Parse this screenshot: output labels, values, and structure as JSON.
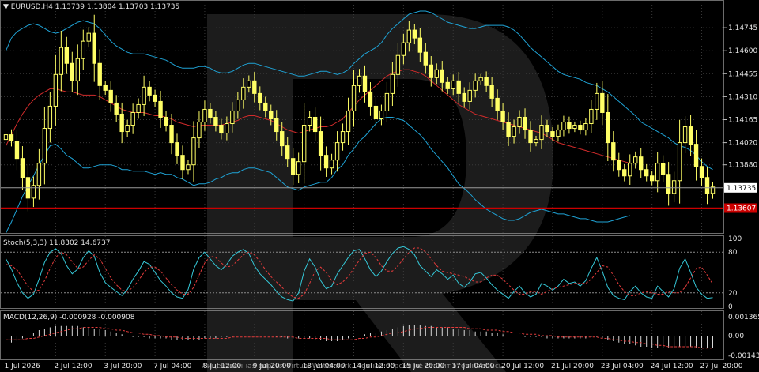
{
  "window": {
    "symbol_header": "EURUSD,H4",
    "ohlc_header": "1.13739 1.13804 1.13703 1.13735",
    "watermark": "Лицензионная версия Virtual Watermark. Полная версия не ставит этот надпись"
  },
  "colors": {
    "background": "#000000",
    "grid": "#3a3a3a",
    "candle": "#ffff66",
    "bb_band": "#1fa3d6",
    "bb_mid": "#d12b2b",
    "stoch_main": "#35c8d8",
    "stoch_signal": "#e23b3b",
    "macd_hist": "#d9d9d9",
    "macd_signal": "#e23b3b",
    "price_line": "#9a9a9a",
    "level_line": "#cc0000",
    "axis_text": "#e6e6e6",
    "bid_tag": "#ffffff",
    "level_tag": "#cc0000"
  },
  "chart_data": [
    {
      "type": "candlestick",
      "name": "",
      "pane": "price",
      "ylim": [
        1.1346,
        1.1487
      ],
      "y_ticks": [
        1.14745,
        1.146,
        1.14455,
        1.1431,
        1.14165,
        1.1402,
        1.1388
      ],
      "current_price": 1.13735,
      "level_price": 1.13607,
      "level_label": "1.13607",
      "current_label": "1.13735",
      "x_ticks": [
        "1 Jul 2026",
        "2 Jul 12:00",
        "3 Jul 20:00",
        "7 Jul 04:00",
        "8 Jul 12:00",
        "9 Jul 20:00",
        "13 Jul 04:00",
        "14 Jul 12:00",
        "15 Jul 20:00",
        "17 Jul 04:00",
        "20 Jul 12:00",
        "21 Jul 20:00",
        "23 Jul 04:00",
        "24 Jul 12:00",
        "27 Jul 20:00"
      ],
      "x_tick_index": [
        0,
        9,
        18,
        27,
        36,
        45,
        54,
        63,
        72,
        81,
        90,
        99,
        108,
        117,
        126
      ],
      "close": [
        1.1407,
        1.1403,
        1.1392,
        1.138,
        1.1367,
        1.1375,
        1.1389,
        1.1411,
        1.1425,
        1.1445,
        1.1462,
        1.1452,
        1.1441,
        1.1455,
        1.1466,
        1.1471,
        1.1452,
        1.1438,
        1.1435,
        1.1427,
        1.142,
        1.1409,
        1.1413,
        1.1421,
        1.1426,
        1.1437,
        1.1432,
        1.1428,
        1.1418,
        1.1413,
        1.1402,
        1.1394,
        1.1385,
        1.1388,
        1.1405,
        1.1415,
        1.1423,
        1.1418,
        1.1413,
        1.1408,
        1.1414,
        1.1422,
        1.1429,
        1.1437,
        1.1441,
        1.1433,
        1.1427,
        1.1422,
        1.1417,
        1.1409,
        1.14,
        1.1392,
        1.1382,
        1.139,
        1.1413,
        1.1418,
        1.1409,
        1.1394,
        1.1386,
        1.1391,
        1.1402,
        1.1409,
        1.1422,
        1.1438,
        1.1444,
        1.1434,
        1.1425,
        1.1417,
        1.1422,
        1.1433,
        1.1445,
        1.1457,
        1.1465,
        1.1473,
        1.1468,
        1.1459,
        1.1451,
        1.1443,
        1.1448,
        1.144,
        1.1436,
        1.1441,
        1.1433,
        1.1428,
        1.1435,
        1.1441,
        1.1443,
        1.1438,
        1.143,
        1.1422,
        1.1415,
        1.1406,
        1.1412,
        1.1418,
        1.141,
        1.1402,
        1.1404,
        1.1413,
        1.1409,
        1.1406,
        1.141,
        1.1415,
        1.1411,
        1.1413,
        1.141,
        1.1414,
        1.1423,
        1.1433,
        1.1421,
        1.1402,
        1.1391,
        1.1385,
        1.1381,
        1.1389,
        1.1393,
        1.1385,
        1.1381,
        1.1378,
        1.1389,
        1.1382,
        1.137,
        1.1378,
        1.1402,
        1.1412,
        1.1401,
        1.1387,
        1.138,
        1.137,
        1.1374
      ],
      "bb_upper": [
        1.146,
        1.1468,
        1.1472,
        1.1474,
        1.1476,
        1.1477,
        1.1476,
        1.1474,
        1.1472,
        1.1471,
        1.1472,
        1.1474,
        1.1476,
        1.1478,
        1.1479,
        1.1478,
        1.1477,
        1.1474,
        1.147,
        1.1466,
        1.1463,
        1.1461,
        1.1459,
        1.1458,
        1.1458,
        1.1458,
        1.1457,
        1.1456,
        1.1455,
        1.1454,
        1.1452,
        1.145,
        1.1449,
        1.1449,
        1.1449,
        1.145,
        1.145,
        1.1449,
        1.1447,
        1.1446,
        1.1446,
        1.1447,
        1.1449,
        1.1451,
        1.1452,
        1.1452,
        1.1451,
        1.145,
        1.1449,
        1.1448,
        1.1447,
        1.1446,
        1.1445,
        1.1444,
        1.1444,
        1.1445,
        1.1446,
        1.1447,
        1.1447,
        1.1446,
        1.1445,
        1.1446,
        1.1448,
        1.1452,
        1.1455,
        1.1458,
        1.146,
        1.1462,
        1.1465,
        1.147,
        1.1474,
        1.1477,
        1.148,
        1.1483,
        1.1484,
        1.1485,
        1.1485,
        1.1484,
        1.1482,
        1.148,
        1.1478,
        1.1477,
        1.1476,
        1.1475,
        1.1474,
        1.1474,
        1.1475,
        1.1476,
        1.1476,
        1.1476,
        1.1476,
        1.1475,
        1.1473,
        1.147,
        1.1466,
        1.1462,
        1.1459,
        1.1456,
        1.1453,
        1.145,
        1.1447,
        1.1445,
        1.1444,
        1.1443,
        1.1442,
        1.144,
        1.1439,
        1.1438,
        1.1436,
        1.1434,
        1.1431,
        1.1428,
        1.1425,
        1.1422,
        1.1419,
        1.1415,
        1.1413,
        1.1411,
        1.1409,
        1.1407,
        1.1405,
        1.1402,
        1.14,
        1.1399,
        1.1397,
        1.1394,
        1.139,
        1.1387,
        1.1385
      ],
      "bb_mid": [
        1.14,
        1.1407,
        1.1414,
        1.142,
        1.1425,
        1.1429,
        1.1432,
        1.1434,
        1.1436,
        1.1436,
        1.1435,
        1.1434,
        1.1434,
        1.1433,
        1.1432,
        1.1432,
        1.1432,
        1.1431,
        1.1429,
        1.1427,
        1.1425,
        1.1423,
        1.1422,
        1.1421,
        1.1421,
        1.1421,
        1.142,
        1.1419,
        1.1419,
        1.1418,
        1.1417,
        1.1415,
        1.1414,
        1.1413,
        1.1412,
        1.1413,
        1.1413,
        1.1413,
        1.1413,
        1.1413,
        1.1414,
        1.1415,
        1.1416,
        1.1418,
        1.1419,
        1.1419,
        1.1418,
        1.1417,
        1.1416,
        1.1414,
        1.1412,
        1.141,
        1.1409,
        1.1408,
        1.1409,
        1.141,
        1.1411,
        1.1412,
        1.1412,
        1.1413,
        1.1415,
        1.1417,
        1.1421,
        1.1425,
        1.1429,
        1.1432,
        1.1435,
        1.1438,
        1.1441,
        1.1444,
        1.1446,
        1.1447,
        1.1448,
        1.1448,
        1.1447,
        1.1446,
        1.1444,
        1.1441,
        1.1438,
        1.1435,
        1.1432,
        1.1429,
        1.1426,
        1.1424,
        1.1422,
        1.142,
        1.1419,
        1.1418,
        1.1417,
        1.1416,
        1.1415,
        1.1414,
        1.1413,
        1.1412,
        1.1411,
        1.141,
        1.1409,
        1.1408,
        1.1406,
        1.1404,
        1.1402,
        1.1401,
        1.14,
        1.1399,
        1.1398,
        1.1397,
        1.1396,
        1.1395,
        1.1394,
        1.1393,
        1.1392,
        1.1391,
        1.139,
        1.1389
      ],
      "bb_lower": [
        1.1345,
        1.1352,
        1.136,
        1.1368,
        1.1375,
        1.1381,
        1.1388,
        1.1394,
        1.14,
        1.1401,
        1.1398,
        1.1394,
        1.1392,
        1.1389,
        1.1386,
        1.1386,
        1.1387,
        1.1388,
        1.1388,
        1.1388,
        1.1387,
        1.1385,
        1.1385,
        1.1384,
        1.1384,
        1.1384,
        1.1383,
        1.1382,
        1.1383,
        1.1382,
        1.1382,
        1.138,
        1.1379,
        1.1377,
        1.1375,
        1.1376,
        1.1376,
        1.1377,
        1.1379,
        1.138,
        1.1382,
        1.1383,
        1.1383,
        1.1385,
        1.1386,
        1.1386,
        1.1385,
        1.1384,
        1.1383,
        1.138,
        1.1377,
        1.1374,
        1.1373,
        1.1372,
        1.1374,
        1.1375,
        1.1376,
        1.1377,
        1.1377,
        1.138,
        1.1385,
        1.1388,
        1.1394,
        1.1398,
        1.1403,
        1.1406,
        1.141,
        1.1414,
        1.1417,
        1.1418,
        1.1418,
        1.1417,
        1.1416,
        1.1413,
        1.141,
        1.1407,
        1.1403,
        1.1398,
        1.1394,
        1.139,
        1.1386,
        1.1381,
        1.1376,
        1.1373,
        1.137,
        1.1366,
        1.1363,
        1.136,
        1.1358,
        1.1356,
        1.1354,
        1.1353,
        1.1353,
        1.1354,
        1.1356,
        1.1358,
        1.1359,
        1.136,
        1.1359,
        1.1358,
        1.1357,
        1.1357,
        1.1356,
        1.1355,
        1.1354,
        1.1354,
        1.1353,
        1.1352,
        1.1352,
        1.1352,
        1.1353,
        1.1354,
        1.1355,
        1.1356
      ]
    },
    {
      "type": "line",
      "name": "Stoch(5,3,3)",
      "pane": "stoch",
      "header": "Stoch(5,3,3) 11.8302 14.6737",
      "ylim": [
        0,
        100
      ],
      "levels": [
        20,
        80
      ],
      "y_ticks": [
        100,
        80,
        20,
        0
      ],
      "main": [
        70,
        55,
        35,
        20,
        12,
        18,
        40,
        65,
        80,
        85,
        78,
        60,
        48,
        55,
        72,
        82,
        74,
        50,
        35,
        28,
        22,
        16,
        25,
        40,
        52,
        66,
        62,
        50,
        38,
        30,
        20,
        14,
        12,
        25,
        55,
        72,
        80,
        70,
        60,
        54,
        62,
        74,
        80,
        84,
        78,
        60,
        48,
        40,
        32,
        22,
        14,
        10,
        8,
        20,
        52,
        70,
        58,
        38,
        26,
        30,
        48,
        60,
        72,
        82,
        84,
        70,
        54,
        44,
        52,
        66,
        78,
        86,
        88,
        84,
        76,
        60,
        52,
        44,
        54,
        48,
        40,
        46,
        34,
        28,
        36,
        48,
        50,
        42,
        32,
        24,
        18,
        12,
        22,
        30,
        20,
        14,
        18,
        34,
        30,
        24,
        30,
        40,
        34,
        36,
        30,
        38,
        56,
        72,
        52,
        28,
        16,
        12,
        10,
        22,
        30,
        20,
        14,
        12,
        30,
        22,
        14,
        26,
        56,
        70,
        50,
        28,
        18,
        12,
        13
      ],
      "signal": [
        62,
        60,
        54,
        42,
        30,
        22,
        24,
        38,
        56,
        72,
        80,
        76,
        66,
        56,
        58,
        68,
        76,
        70,
        56,
        42,
        32,
        24,
        22,
        28,
        38,
        50,
        58,
        58,
        52,
        42,
        32,
        24,
        18,
        18,
        28,
        46,
        64,
        74,
        72,
        64,
        58,
        60,
        68,
        76,
        80,
        76,
        66,
        54,
        44,
        36,
        28,
        20,
        14,
        12,
        18,
        34,
        52,
        58,
        50,
        38,
        32,
        36,
        44,
        56,
        68,
        78,
        80,
        72,
        60,
        52,
        52,
        60,
        70,
        80,
        86,
        86,
        80,
        70,
        60,
        52,
        50,
        48,
        46,
        44,
        40,
        36,
        36,
        42,
        46,
        46,
        40,
        32,
        24,
        18,
        18,
        22,
        22,
        18,
        22,
        26,
        28,
        30,
        32,
        34,
        34,
        34,
        40,
        50,
        60,
        58,
        46,
        32,
        22,
        16,
        16,
        20,
        22,
        20,
        18,
        18,
        22,
        20,
        20,
        28,
        42,
        56,
        58,
        46,
        33
      ]
    },
    {
      "type": "bar",
      "name": "MACD(12,26,9)",
      "pane": "macd",
      "header": "MACD(12,26,9) -0.000928 -0.000908",
      "ylim": [
        -0.0016,
        0.0016
      ],
      "y_ticks": [
        0.00136,
        0.0,
        -0.00143
      ],
      "y_tick_labels": [
        "0.001365",
        "0.00",
        "-0.001433"
      ],
      "hist": [
        -0.0006,
        -0.0005,
        -0.0004,
        -0.0002,
        0.0,
        0.0002,
        0.0004,
        0.0005,
        0.0006,
        0.0007,
        0.0007,
        0.0007,
        0.0007,
        0.0007,
        0.0006,
        0.0006,
        0.0005,
        0.0005,
        0.0004,
        0.0003,
        0.0002,
        0.0001,
        0.0,
        -0.0001,
        -0.0001,
        -0.0001,
        -0.0002,
        -0.0002,
        -0.0002,
        -0.0002,
        -0.0003,
        -0.0003,
        -0.0003,
        -0.0003,
        -0.0003,
        -0.0003,
        -0.0002,
        -0.0002,
        -0.0002,
        -0.0001,
        -0.0001,
        -0.0001,
        0.0,
        0.0,
        0.0,
        0.0,
        0.0,
        0.0,
        0.0,
        -0.0001,
        -0.0001,
        -0.0002,
        -0.0002,
        -0.0002,
        -0.0002,
        -0.0002,
        -0.0003,
        -0.0003,
        -0.0004,
        -0.0004,
        -0.0004,
        -0.0003,
        -0.0002,
        -0.0001,
        0.0,
        0.0001,
        0.0002,
        0.0002,
        0.0003,
        0.0004,
        0.0005,
        0.0006,
        0.0007,
        0.0008,
        0.0008,
        0.0008,
        0.0007,
        0.0007,
        0.0006,
        0.0006,
        0.0006,
        0.0005,
        0.0005,
        0.0004,
        0.0004,
        0.0003,
        0.0003,
        0.0003,
        0.0002,
        0.0002,
        0.0001,
        0.0,
        0.0,
        0.0,
        -0.0001,
        -0.0001,
        -0.0001,
        -0.0001,
        -0.0002,
        -0.0002,
        -0.0002,
        -0.0002,
        -0.0002,
        -0.0002,
        -0.0002,
        -0.0002,
        -0.0001,
        -0.0001,
        -0.0002,
        -0.0003,
        -0.0004,
        -0.0005,
        -0.0006,
        -0.0006,
        -0.0007,
        -0.0008,
        -0.0008,
        -0.0009,
        -0.0009,
        -0.0009,
        -0.0009,
        -0.0009,
        -0.0008,
        -0.0008,
        -0.0008,
        -0.0009,
        -0.0009,
        -0.0009,
        -0.0009
      ],
      "signal": [
        -0.0003,
        -0.0003,
        -0.0003,
        -0.0003,
        -0.0002,
        -0.0002,
        -0.0001,
        0.0,
        0.0001,
        0.0002,
        0.0003,
        0.0004,
        0.0005,
        0.0005,
        0.0006,
        0.0006,
        0.0006,
        0.0006,
        0.0005,
        0.0005,
        0.0004,
        0.0004,
        0.0003,
        0.0002,
        0.0002,
        0.0001,
        0.0001,
        0.0,
        0.0,
        -0.0001,
        -0.0001,
        -0.0001,
        -0.0002,
        -0.0002,
        -0.0002,
        -0.0002,
        -0.0002,
        -0.0002,
        -0.0002,
        -0.0002,
        -0.0002,
        -0.0001,
        -0.0001,
        -0.0001,
        -0.0001,
        -0.0001,
        -0.0001,
        -0.0001,
        -0.0001,
        -0.0001,
        -0.0001,
        -0.0001,
        -0.0001,
        -0.0002,
        -0.0002,
        -0.0002,
        -0.0002,
        -0.0002,
        -0.0002,
        -0.0003,
        -0.0003,
        -0.0003,
        -0.0003,
        -0.0003,
        -0.0002,
        -0.0002,
        -0.0001,
        -0.0001,
        0.0,
        0.0001,
        0.0002,
        0.0002,
        0.0003,
        0.0004,
        0.0005,
        0.0005,
        0.0006,
        0.0006,
        0.0006,
        0.0006,
        0.0006,
        0.0006,
        0.0006,
        0.0006,
        0.0005,
        0.0005,
        0.0005,
        0.0004,
        0.0004,
        0.0004,
        0.0003,
        0.0003,
        0.0002,
        0.0002,
        0.0001,
        0.0001,
        0.0001,
        0.0,
        0.0,
        0.0,
        -0.0001,
        -0.0001,
        -0.0001,
        -0.0001,
        -0.0001,
        -0.0001,
        -0.0001,
        -0.0001,
        -0.0002,
        -0.0002,
        -0.0003,
        -0.0003,
        -0.0004,
        -0.0004,
        -0.0005,
        -0.0005,
        -0.0006,
        -0.0006,
        -0.0007,
        -0.0007,
        -0.0008,
        -0.0008,
        -0.0008,
        -0.0008,
        -0.0008,
        -0.0008,
        -0.0009,
        -0.0009,
        -0.0009
      ]
    }
  ]
}
